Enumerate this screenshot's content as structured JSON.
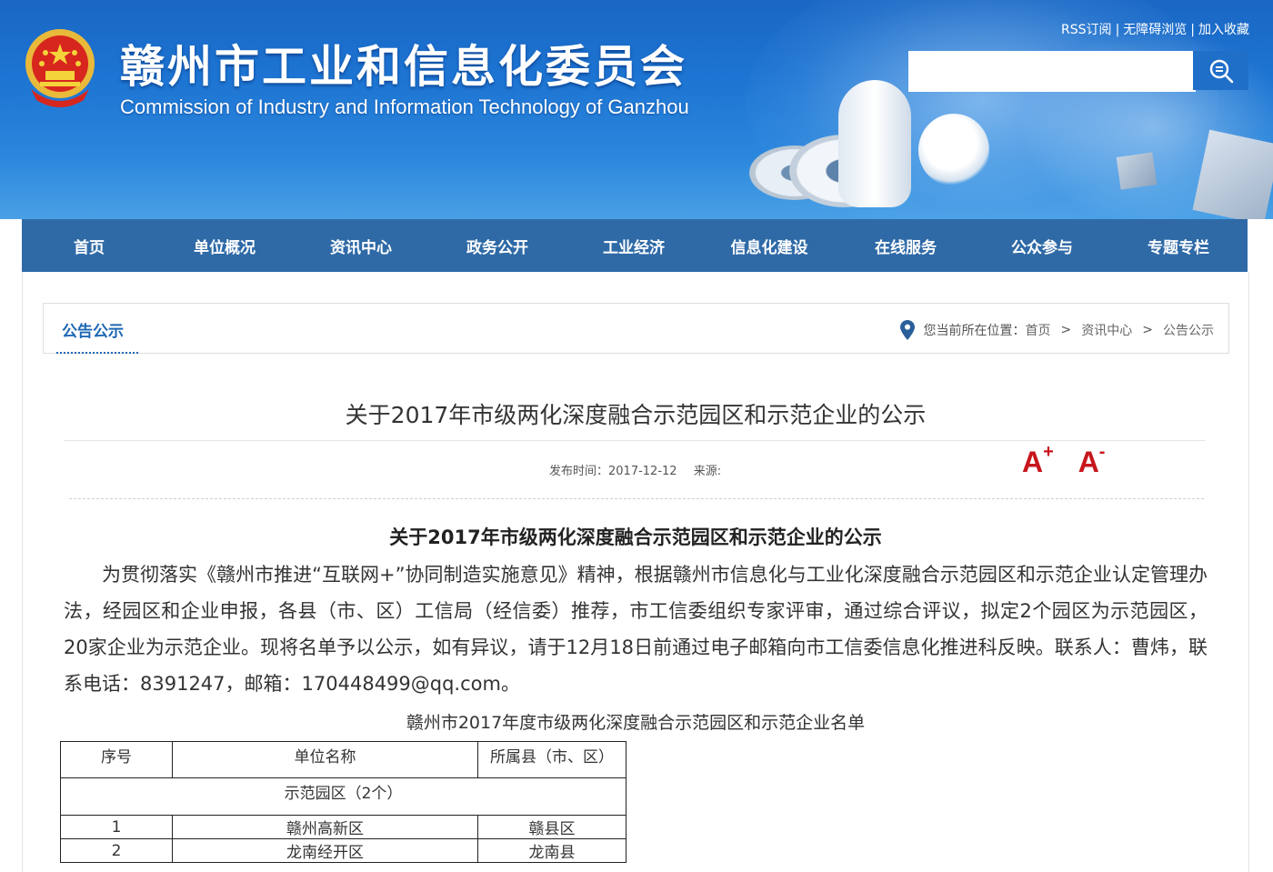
{
  "header": {
    "title": "赣州市工业和信息化委员会",
    "subtitle": "Commission of Industry and Information Technology of Ganzhou",
    "top_links": [
      "RSS订阅",
      "无障碍浏览",
      "加入收藏"
    ],
    "search_placeholder": ""
  },
  "nav": {
    "items": [
      "首页",
      "单位概况",
      "资讯中心",
      "政务公开",
      "工业经济",
      "信息化建设",
      "在线服务",
      "公众参与",
      "专题专栏"
    ]
  },
  "breadcrumb": {
    "section": "公告公示",
    "location_label": "您当前所在位置：",
    "path": [
      "首页",
      "资讯中心",
      "公告公示"
    ]
  },
  "article": {
    "title": "关于2017年市级两化深度融合示范园区和示范企业的公示",
    "publish_label": "发布时间：2017-12-12",
    "source_label": "来源:",
    "font_increase": "A",
    "font_decrease": "A",
    "body_heading": "关于2017年市级两化深度融合示范园区和示范企业的公示",
    "body_paragraph": "为贯彻落实《赣州市推进“互联网+”协同制造实施意见》精神，根据赣州市信息化与工业化深度融合示范园区和示范企业认定管理办法，经园区和企业申报，各县（市、区）工信局（经信委）推荐，市工信委组织专家评审，通过综合评议，拟定2个园区为示范园区，20家企业为示范企业。现将名单予以公示，如有异议，请于12月18日前通过电子邮箱向市工信委信息化推进科反映。联系人：曹炜，联系电话：8391247，邮箱：170448499@qq.com。",
    "table_caption": "赣州市2017年度市级两化深度融合示范园区和示范企业名单",
    "table": {
      "headers": [
        "序号",
        "单位名称",
        "所属县（市、区）"
      ],
      "group_label": "示范园区（2个）",
      "rows": [
        [
          "1",
          "赣州高新区",
          "赣县区"
        ],
        [
          "2",
          "龙南经开区",
          "龙南县"
        ]
      ]
    }
  }
}
